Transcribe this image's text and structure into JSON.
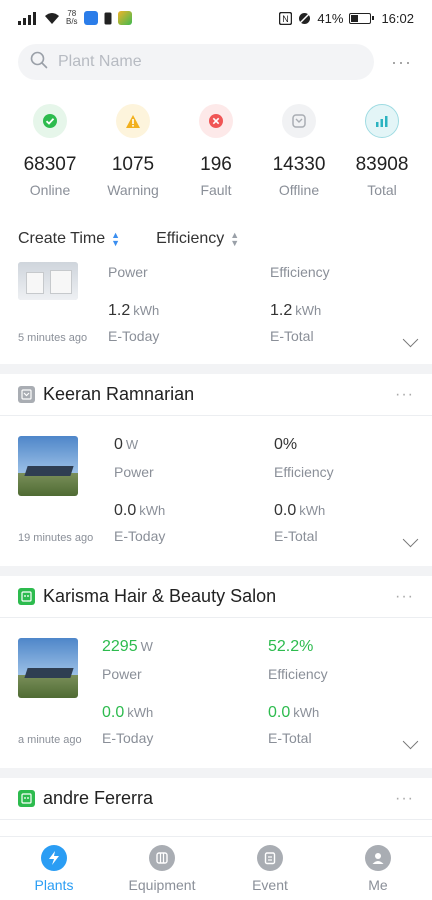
{
  "status_bar": {
    "net_speed_top": "78",
    "net_speed_bottom": "B/s",
    "battery_percent": "41%",
    "battery_level": 0.41,
    "time": "16:02"
  },
  "search": {
    "placeholder": "Plant Name",
    "more": "···"
  },
  "stats": [
    {
      "value": "68307",
      "label": "Online",
      "icon": "check-circle-icon",
      "color": "#2dbb4e"
    },
    {
      "value": "1075",
      "label": "Warning",
      "icon": "warning-triangle-icon",
      "color": "#f2b01e"
    },
    {
      "value": "196",
      "label": "Fault",
      "icon": "fault-x-icon",
      "color": "#f05555"
    },
    {
      "value": "14330",
      "label": "Offline",
      "icon": "offline-icon",
      "color": "#a9adb3"
    },
    {
      "value": "83908",
      "label": "Total",
      "icon": "total-chart-icon",
      "color": "#2bb3c0"
    }
  ],
  "sort": {
    "create_time": "Create Time",
    "efficiency": "Efficiency"
  },
  "plants": [
    {
      "name": "",
      "time_ago": "5 minutes ago",
      "power_value": "",
      "power_unit": "",
      "power_label": "Power",
      "efficiency_value": "",
      "efficiency_label": "Efficiency",
      "etoday_value": "1.2",
      "etoday_unit": "kWh",
      "etoday_label": "E-Today",
      "etotal_value": "1.2",
      "etotal_unit": "kWh",
      "etotal_label": "E-Total"
    },
    {
      "name": "Keeran Ramnarian",
      "status": "offline",
      "time_ago": "19 minutes ago",
      "power_value": "0",
      "power_unit": "W",
      "power_label": "Power",
      "efficiency_value": "0%",
      "efficiency_label": "Efficiency",
      "etoday_value": "0.0",
      "etoday_unit": "kWh",
      "etoday_label": "E-Today",
      "etotal_value": "0.0",
      "etotal_unit": "kWh",
      "etotal_label": "E-Total",
      "more": "···"
    },
    {
      "name": "Karisma Hair & Beauty Salon",
      "status": "online",
      "time_ago": "a minute ago",
      "power_value": "2295",
      "power_unit": "W",
      "power_label": "Power",
      "efficiency_value": "52.2%",
      "efficiency_label": "Efficiency",
      "etoday_value": "0.0",
      "etoday_unit": "kWh",
      "etoday_label": "E-Today",
      "etotal_value": "0.0",
      "etotal_unit": "kWh",
      "etotal_label": "E-Total",
      "more": "···"
    },
    {
      "name": "andre Fererra",
      "status": "online",
      "more": "···"
    }
  ],
  "nav": [
    {
      "label": "Plants",
      "icon": "lightning-icon",
      "active": true
    },
    {
      "label": "Equipment",
      "icon": "equipment-icon",
      "active": false
    },
    {
      "label": "Event",
      "icon": "event-icon",
      "active": false
    },
    {
      "label": "Me",
      "icon": "user-icon",
      "active": false
    }
  ],
  "colors": {
    "accent_blue": "#2a9df4",
    "online_green": "#2dbb4e",
    "muted_text": "#8a8f98"
  }
}
